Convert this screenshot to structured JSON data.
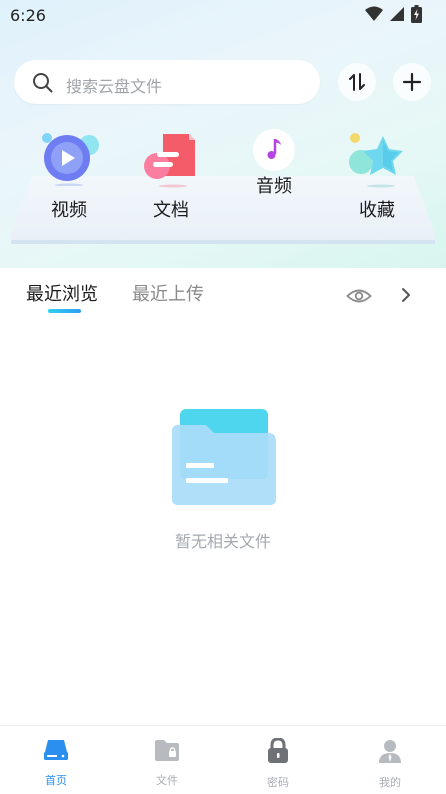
{
  "status_bar": {
    "time": "6:26"
  },
  "search": {
    "placeholder": "搜索云盘文件"
  },
  "categories": [
    {
      "label": "视频",
      "icon": "video-icon"
    },
    {
      "label": "文档",
      "icon": "document-icon"
    },
    {
      "label": "音频",
      "icon": "music-note-icon"
    },
    {
      "label": "收藏",
      "icon": "star-icon"
    }
  ],
  "tabs": [
    {
      "label": "最近浏览",
      "active": true
    },
    {
      "label": "最近上传",
      "active": false
    }
  ],
  "empty_state": {
    "text": "暂无相关文件"
  },
  "bottom_nav": [
    {
      "label": "首页",
      "active": true,
      "icon": "home-drive-icon"
    },
    {
      "label": "文件",
      "active": false,
      "icon": "folder-lock-icon"
    },
    {
      "label": "密码",
      "active": false,
      "icon": "padlock-icon"
    },
    {
      "label": "我的",
      "active": false,
      "icon": "person-icon"
    }
  ],
  "colors": {
    "accent": "#2f9bf0",
    "nav_active": "#2b8ff0",
    "nav_inactive": "#a9adb3",
    "empty_text": "#a4a9b0"
  }
}
